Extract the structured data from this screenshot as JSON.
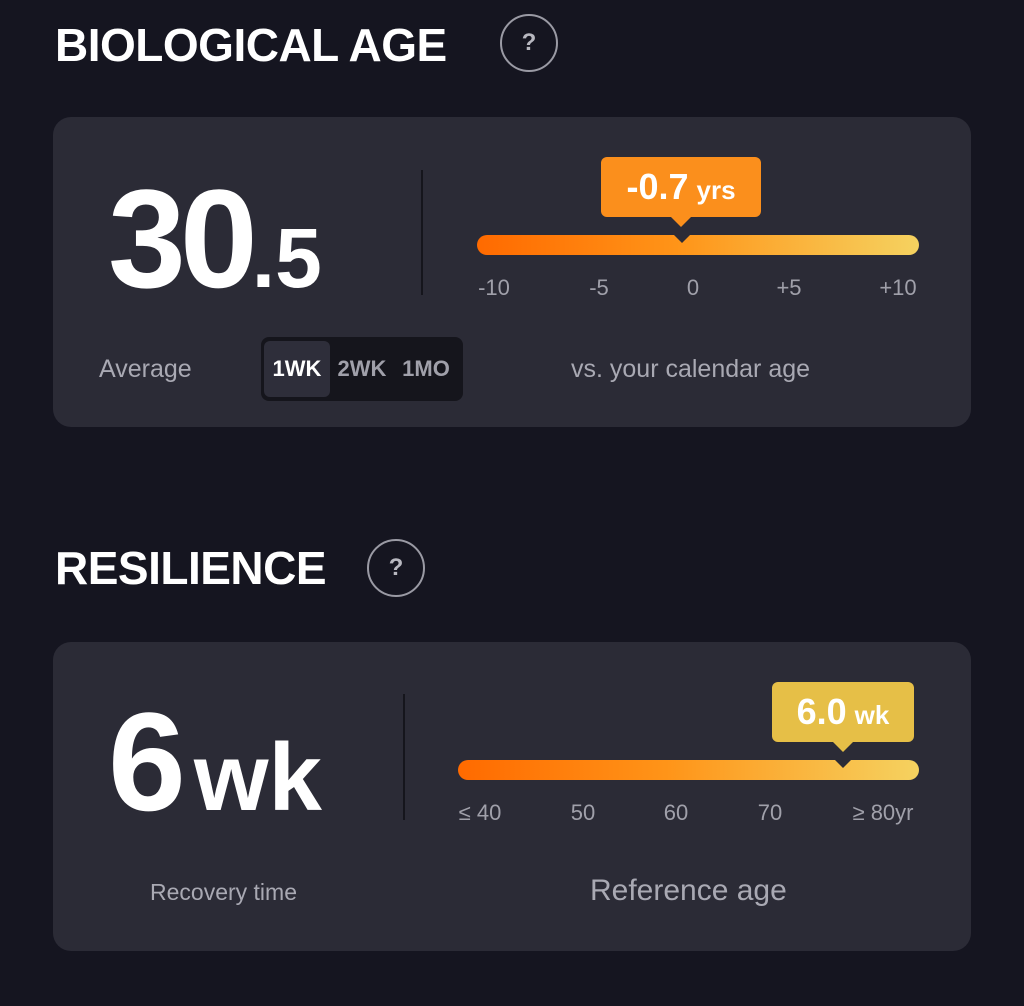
{
  "biological_age": {
    "title": "BIOLOGICAL AGE",
    "help": "?",
    "value_int": "30",
    "value_dec": ".5",
    "average_label": "Average",
    "periods": [
      "1WK",
      "2WK",
      "1MO"
    ],
    "selected_period": "1WK",
    "delta_value": "-0.7",
    "delta_unit": "yrs",
    "delta_numeric": -0.7,
    "scale_min": -10,
    "scale_max": 10,
    "ticks": [
      "-10",
      "-5",
      "0",
      "+5",
      "+10"
    ],
    "caption": "vs. your calendar age",
    "colors": {
      "callout": "#fb8f1c",
      "track_start": "#ff6a00",
      "track_end": "#f5d260"
    }
  },
  "resilience": {
    "title": "RESILIENCE",
    "help": "?",
    "value": "6",
    "unit": "wk",
    "caption_left": "Recovery time",
    "callout_value": "6.0",
    "callout_unit": "wk",
    "reference_age_fraction": 0.87,
    "ticks": [
      "≤ 40",
      "50",
      "60",
      "70",
      "≥ 80yr"
    ],
    "caption_right": "Reference age",
    "colors": {
      "callout": "#e6bf47"
    }
  }
}
